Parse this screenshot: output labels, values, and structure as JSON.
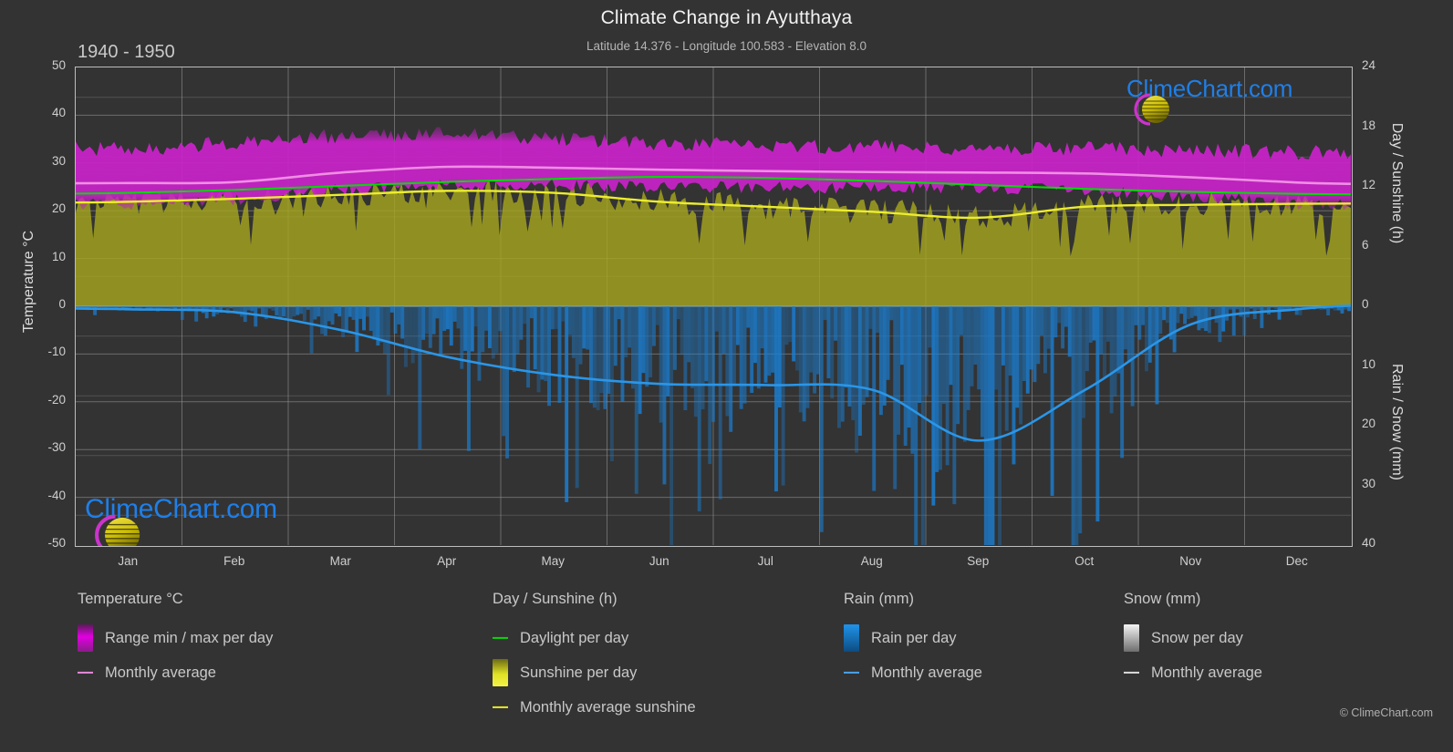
{
  "header": {
    "title": "Climate Change in Ayutthaya",
    "subtitle": "Latitude 14.376 - Longitude 100.583 - Elevation 8.0",
    "period": "1940 - 1950"
  },
  "branding": {
    "watermark_text": "ClimeChart.com",
    "copyright": "© ClimeChart.com",
    "logo_arc_color": "#cc33cc",
    "logo_sphere_color": "#d4c60a",
    "logo_text_color": "#1f7fe8"
  },
  "legend": {
    "columns": [
      {
        "title": "Temperature °C",
        "items": [
          {
            "label": "Range min / max per day",
            "marker": "swatch",
            "color": "#e000e0"
          },
          {
            "label": "Monthly average",
            "marker": "line",
            "color": "#e48ad8"
          }
        ]
      },
      {
        "title": "Day / Sunshine (h)",
        "items": [
          {
            "label": "Daylight per day",
            "marker": "line",
            "color": "#0ad60a"
          },
          {
            "label": "Sunshine per day",
            "marker": "swatch",
            "color": "#e8e82a"
          },
          {
            "label": "Monthly average sunshine",
            "marker": "line",
            "color": "#e8e82a"
          }
        ]
      },
      {
        "title": "Rain (mm)",
        "items": [
          {
            "label": "Rain per day",
            "marker": "swatch",
            "color": "#1186e0"
          },
          {
            "label": "Monthly average",
            "marker": "line",
            "color": "#4aa3e8"
          }
        ]
      },
      {
        "title": "Snow (mm)",
        "items": [
          {
            "label": "Snow per day",
            "marker": "swatch",
            "color": "#e8e8e8"
          },
          {
            "label": "Monthly average",
            "marker": "line",
            "color": "#dcdcdc"
          }
        ]
      }
    ]
  },
  "chart_data": {
    "type": "area",
    "title": "Climate Change in Ayutthaya",
    "subtitle": "Latitude 14.376 - Longitude 100.583 - Elevation 8.0",
    "period": "1940 - 1950",
    "grid": true,
    "legend_position": "below",
    "xlabel": "",
    "categories": [
      "Jan",
      "Feb",
      "Mar",
      "Apr",
      "May",
      "Jun",
      "Jul",
      "Aug",
      "Sep",
      "Oct",
      "Nov",
      "Dec"
    ],
    "axes": {
      "left": {
        "label": "Temperature °C",
        "min": -50,
        "max": 50,
        "step": 10,
        "ticks": [
          50,
          40,
          30,
          20,
          10,
          0,
          -10,
          -20,
          -30,
          -40,
          -50
        ]
      },
      "right_top": {
        "label": "Day / Sunshine (h)",
        "min": 0,
        "max": 24,
        "step": 6,
        "ticks": [
          24,
          18,
          12,
          6,
          0
        ],
        "maps_to_temperature_range": [
          0,
          50
        ]
      },
      "right_bottom": {
        "label": "Rain / Snow (mm)",
        "min": 0,
        "max": 40,
        "step": 10,
        "ticks": [
          0,
          10,
          20,
          30,
          40
        ],
        "maps_to_temperature_range": [
          0,
          -50
        ]
      }
    },
    "series": [
      {
        "name": "Temperature range min / max per day",
        "type": "band",
        "unit": "°C",
        "color": "#e000e0",
        "monthly_max": [
          32.8,
          34.0,
          35.5,
          36.0,
          35.0,
          34.0,
          33.5,
          33.2,
          33.0,
          32.8,
          32.5,
          32.0
        ],
        "monthly_min": [
          21.5,
          22.5,
          24.5,
          25.5,
          25.5,
          25.2,
          25.0,
          25.0,
          24.8,
          24.5,
          23.0,
          21.5
        ]
      },
      {
        "name": "Temperature monthly average",
        "type": "line",
        "unit": "°C",
        "color": "#e48ad8",
        "values": [
          25.8,
          26.0,
          28.0,
          29.2,
          29.0,
          28.6,
          28.3,
          28.1,
          28.0,
          27.8,
          27.0,
          25.9
        ]
      },
      {
        "name": "Daylight per day",
        "type": "line",
        "unit": "h",
        "color": "#0ad60a",
        "values": [
          11.4,
          11.7,
          12.1,
          12.5,
          12.8,
          13.0,
          12.9,
          12.6,
          12.2,
          11.8,
          11.5,
          11.3
        ]
      },
      {
        "name": "Sunshine per day",
        "type": "area",
        "unit": "h",
        "color": "#b3b31f",
        "values": [
          10.5,
          10.8,
          11.2,
          11.6,
          11.4,
          10.5,
          10.0,
          9.5,
          8.9,
          10.0,
          10.2,
          10.3
        ]
      },
      {
        "name": "Monthly average sunshine",
        "type": "line",
        "unit": "h",
        "color": "#e8e82a",
        "values": [
          10.5,
          10.8,
          11.2,
          11.6,
          11.4,
          10.5,
          10.0,
          9.5,
          8.9,
          10.0,
          10.2,
          10.3
        ]
      },
      {
        "name": "Rain per day",
        "type": "bars",
        "unit": "mm",
        "color": "#1186e0",
        "daily_max_observed": 40
      },
      {
        "name": "Rain monthly average",
        "type": "line",
        "unit": "mm",
        "color": "#4aa3e8",
        "values": [
          0.5,
          1.0,
          4.0,
          8.5,
          11.5,
          13.0,
          13.2,
          14.0,
          22.5,
          14.0,
          3.0,
          0.5
        ]
      },
      {
        "name": "Snow per day",
        "type": "bars",
        "unit": "mm",
        "color": "#e8e8e8",
        "values": [
          0,
          0,
          0,
          0,
          0,
          0,
          0,
          0,
          0,
          0,
          0,
          0
        ]
      },
      {
        "name": "Snow monthly average",
        "type": "line",
        "unit": "mm",
        "color": "#dcdcdc",
        "values": [
          0,
          0,
          0,
          0,
          0,
          0,
          0,
          0,
          0,
          0,
          0,
          0
        ]
      }
    ]
  }
}
